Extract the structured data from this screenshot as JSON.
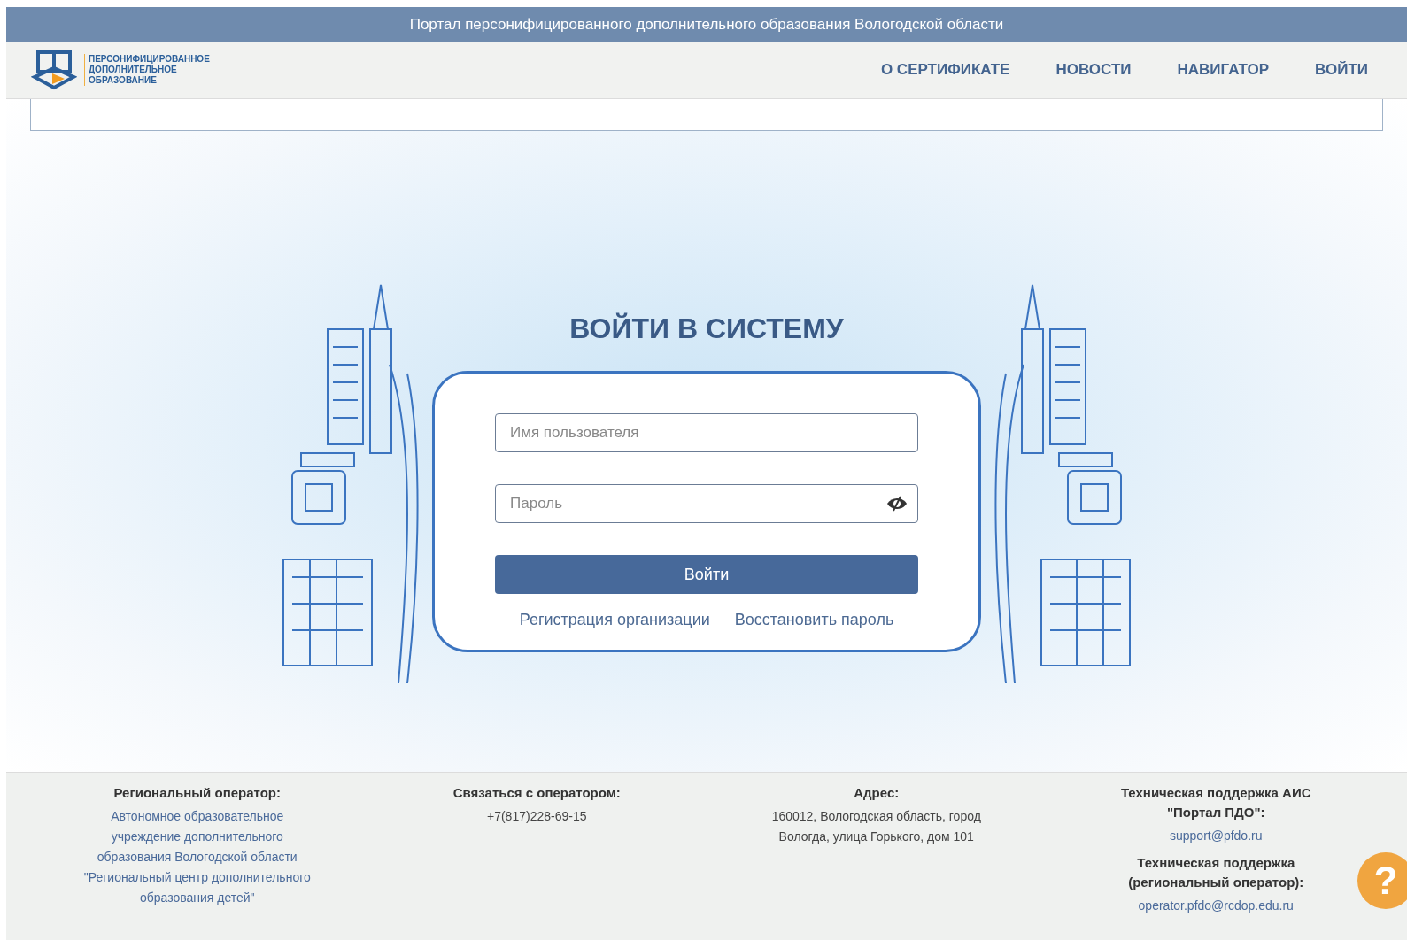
{
  "header": {
    "title": "Портал персонифицированного дополнительного образования Вологодской области"
  },
  "logo": {
    "lines": [
      "ПЕРСОНИФИЦИРОВАННОЕ",
      "ДОПОЛНИТЕЛЬНОЕ",
      "ОБРАЗОВАНИЕ"
    ]
  },
  "nav": [
    {
      "label": "О СЕРТИФИКАТЕ"
    },
    {
      "label": "НОВОСТИ"
    },
    {
      "label": "НАВИГАТОР"
    },
    {
      "label": "ВОЙТИ"
    }
  ],
  "login": {
    "title": "ВОЙТИ В СИСТЕМУ",
    "username": {
      "placeholder": "Имя пользователя"
    },
    "password": {
      "placeholder": "Пароль"
    },
    "submit": "Войти",
    "links": [
      "Регистрация организации",
      "Восстановить пароль"
    ]
  },
  "footer": {
    "columns": [
      {
        "items": [
          {
            "kind": "title",
            "text": "Региональный оператор:"
          },
          {
            "kind": "link",
            "text": "Автономное образовательное учреждение дополнительного образования Вологодской области \"Региональный центр дополнительного образования детей\""
          }
        ]
      },
      {
        "items": [
          {
            "kind": "title",
            "text": "Связаться с оператором:"
          },
          {
            "kind": "text",
            "text": "+7(817)228-69-15"
          }
        ]
      },
      {
        "items": [
          {
            "kind": "title",
            "text": "Адрес:"
          },
          {
            "kind": "text",
            "text": "160012, Вологодская область, город Вологда, улица Горького, дом 101"
          }
        ]
      },
      {
        "items": [
          {
            "kind": "title",
            "text": "Техническая поддержка АИС \"Портал ПДО\":"
          },
          {
            "kind": "link",
            "text": "support@pfdo.ru"
          },
          {
            "kind": "title",
            "text": "Техническая поддержка (региональный оператор):"
          },
          {
            "kind": "link",
            "text": "operator.pfdo@rcdop.edu.ru"
          }
        ]
      }
    ]
  },
  "help": {
    "label": "?"
  }
}
